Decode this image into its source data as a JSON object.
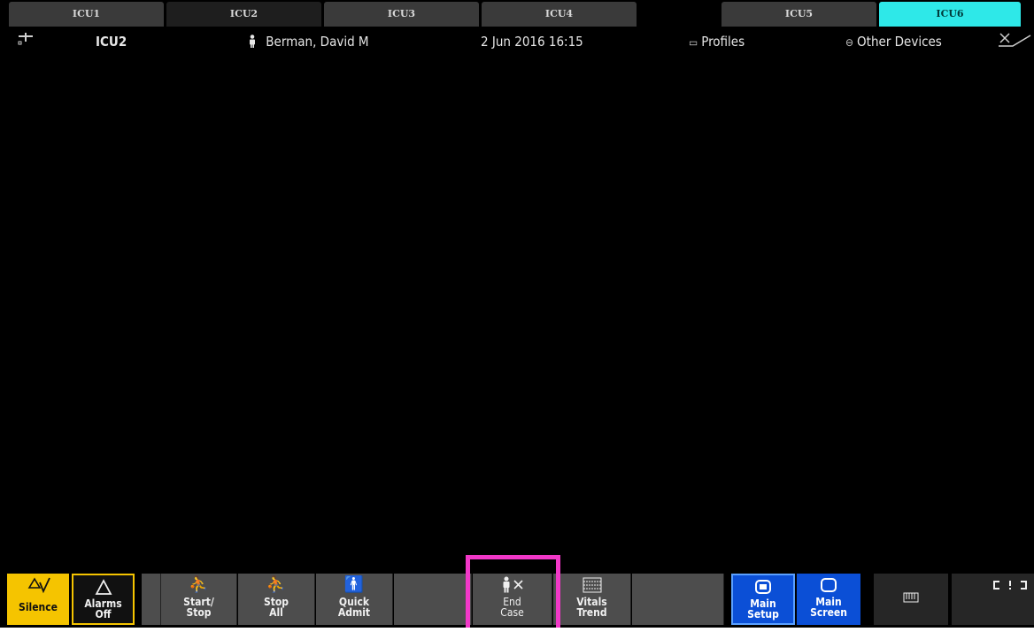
{
  "tabs": [
    "ICU1",
    "ICU2",
    "ICU3",
    "ICU4",
    "",
    "ICU5",
    "ICU6"
  ],
  "status": {
    "bed": "ICU2",
    "patient_name": "Berman, David M",
    "datetime": "2 Jun 2016 16:15",
    "profiles_label": "Profiles",
    "other_devices_label": "Other Devices"
  },
  "softkeys": {
    "silence": "Silence",
    "alarms_off": [
      "Alarms",
      "Off"
    ],
    "start_stop": [
      "Start/",
      "Stop"
    ],
    "stop_all": [
      "Stop",
      "All"
    ],
    "quick_admit": [
      "Quick",
      "Admit"
    ],
    "end_case": [
      "End",
      "Case"
    ],
    "vitals_trend": [
      "Vitals",
      "Trend"
    ],
    "main_setup": [
      "Main",
      "Setup"
    ],
    "main_screen": [
      "Main",
      "Screen"
    ]
  },
  "icons": {
    "network": "network-icon",
    "person": "person-icon",
    "profiles": "profiles-icon",
    "other_devices": "other-devices-icon",
    "alarm_status": "alarm-crossed-icon",
    "silence": "silence-bell-icon",
    "alarms_off": "alarm-triangle-icon",
    "start_stop": "start-stop-icon",
    "stop_all": "stop-all-icon",
    "quick_admit": "quick-admit-icon",
    "end_case": "end-case-icon",
    "vitals_trend": "vitals-trend-icon",
    "main_setup": "main-setup-icon",
    "main_screen": "main-screen-icon",
    "keyboard": "keyboard-icon",
    "expand": "expand-icon"
  },
  "colors": {
    "selected_tab": "#2ee8e8",
    "alarm_yellow": "#f5c400",
    "setup_blue": "#0b4fd6",
    "highlight": "#f238c8"
  }
}
